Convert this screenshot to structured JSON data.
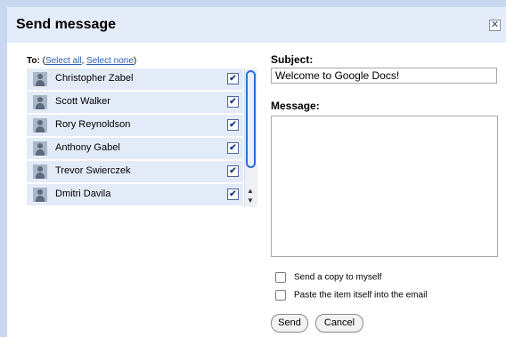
{
  "dialog": {
    "title": "Send message",
    "close_glyph": "✕",
    "icons": [
      "close-icon",
      "avatar-icon",
      "checkbox-checked-icon",
      "scroll-up-icon",
      "scroll-down-icon"
    ]
  },
  "to": {
    "label": "To:",
    "open_paren": "(",
    "select_all": "Select all",
    "comma": ", ",
    "select_none": "Select none",
    "close_paren": ")"
  },
  "recipients": [
    {
      "name": "Christopher Zabel",
      "checked": true
    },
    {
      "name": "Scott Walker",
      "checked": true
    },
    {
      "name": "Rory Reynoldson",
      "checked": true
    },
    {
      "name": "Anthony Gabel",
      "checked": true
    },
    {
      "name": "Trevor Swierczek",
      "checked": true
    },
    {
      "name": "Dmitri Davila",
      "checked": true
    }
  ],
  "check_glyph": "✔",
  "subject": {
    "label": "Subject:",
    "value": "Welcome to Google Docs!"
  },
  "message": {
    "label": "Message:",
    "value": ""
  },
  "options": {
    "send_copy": "Send a copy to myself",
    "paste_item": "Paste the item itself into the email"
  },
  "buttons": {
    "send": "Send",
    "cancel": "Cancel"
  },
  "colors": {
    "header_bg": "#e5ecf9",
    "row_bg": "#e3ebf8",
    "link": "#2a5db0",
    "scroll_thumb": "#2b6fd6"
  }
}
